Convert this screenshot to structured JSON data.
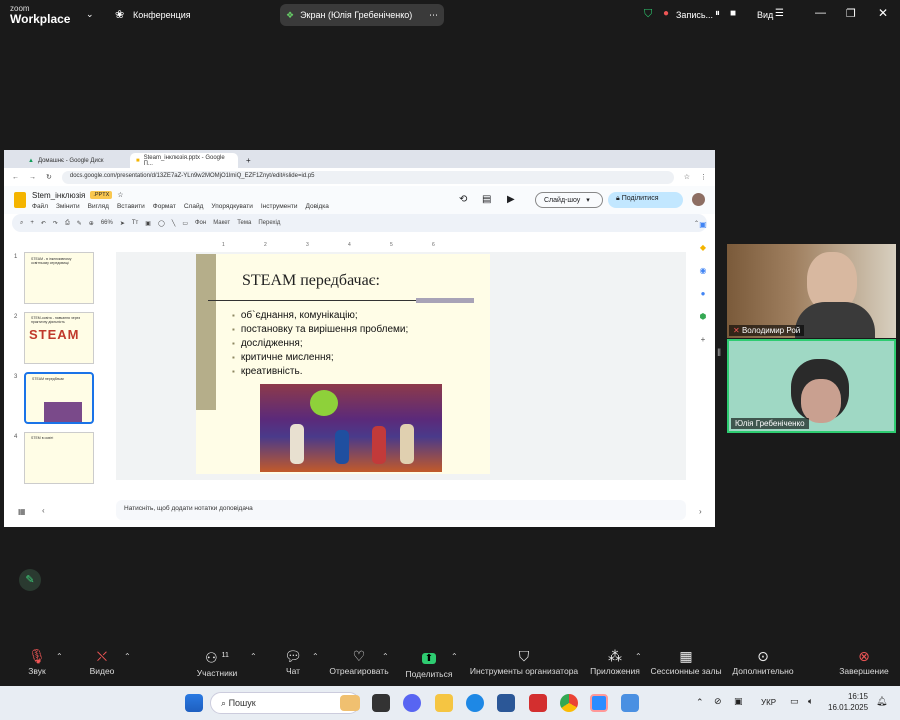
{
  "zoom": {
    "brand_top": "zoom",
    "brand_bottom": "Workplace",
    "meeting_label": "Конференция",
    "screen_share_label": "Экран (Юлія Гребеніченко)",
    "recording_label": "Запись...",
    "view_label": "Вид"
  },
  "browser": {
    "tabs": [
      {
        "label": "Домашнє - Google Диск"
      },
      {
        "label": "Steam_інклюзія.pptx - Google П..."
      }
    ],
    "url": "docs.google.com/presentation/d/13ZE7aZ-YLn9w2MOMjO1lmiQ_EZF1Znyt/edit#slide=id.p5"
  },
  "slides_app": {
    "title": "Stem_інклюзія",
    "badge": ".PPTX",
    "menu": [
      "Файл",
      "Змінити",
      "Вигляд",
      "Вставити",
      "Формат",
      "Слайд",
      "Упорядкувати",
      "Інструменти",
      "Довідка"
    ],
    "slideshow_label": "Слайд-шоу",
    "share_label": "Поділитися",
    "zoom_level": "66%",
    "tb_background": "Фон",
    "tb_layout": "Макет",
    "tb_theme": "Тема",
    "tb_transition": "Перехід",
    "notes_placeholder": "Натисніть, щоб додати нотатки доповідача",
    "thumbnails": [
      {
        "num": "1",
        "title": "STEAM - в інклюзивному освітньому середовищі"
      },
      {
        "num": "2",
        "title": "STEM-освіта - навчання через практичну діяльність"
      },
      {
        "num": "3",
        "title": "STEAM передбачає"
      },
      {
        "num": "4",
        "title": "STEM в освіті"
      }
    ],
    "steam_letters": "STEAM",
    "current_slide": {
      "title": "STEAM передбачає:",
      "bullets": [
        "об`єднання, комунікацію;",
        "постановку та вирішення проблеми;",
        "дослідження;",
        "критичне мислення;",
        "креативність."
      ]
    }
  },
  "participants": [
    {
      "name": "Володимир Рой"
    },
    {
      "name": "Юлія Гребеніченко"
    }
  ],
  "bottom_bar": {
    "audio": "Звук",
    "video": "Видео",
    "participants": "Участники",
    "participants_count": "11",
    "chat": "Чат",
    "react": "Отреагировать",
    "share": "Поделиться",
    "host_tools": "Инструменты организатора",
    "apps": "Приложения",
    "breakout": "Сессионные залы",
    "more": "Дополнительно",
    "end": "Завершение"
  },
  "taskbar": {
    "search_placeholder": "Пошук",
    "lang": "УКР",
    "time": "16:15",
    "date": "16.01.2025"
  },
  "colors": {
    "zoom_bg": "#1a1a1a",
    "accent": "#1a73e8",
    "share_green": "#2ecc71"
  }
}
